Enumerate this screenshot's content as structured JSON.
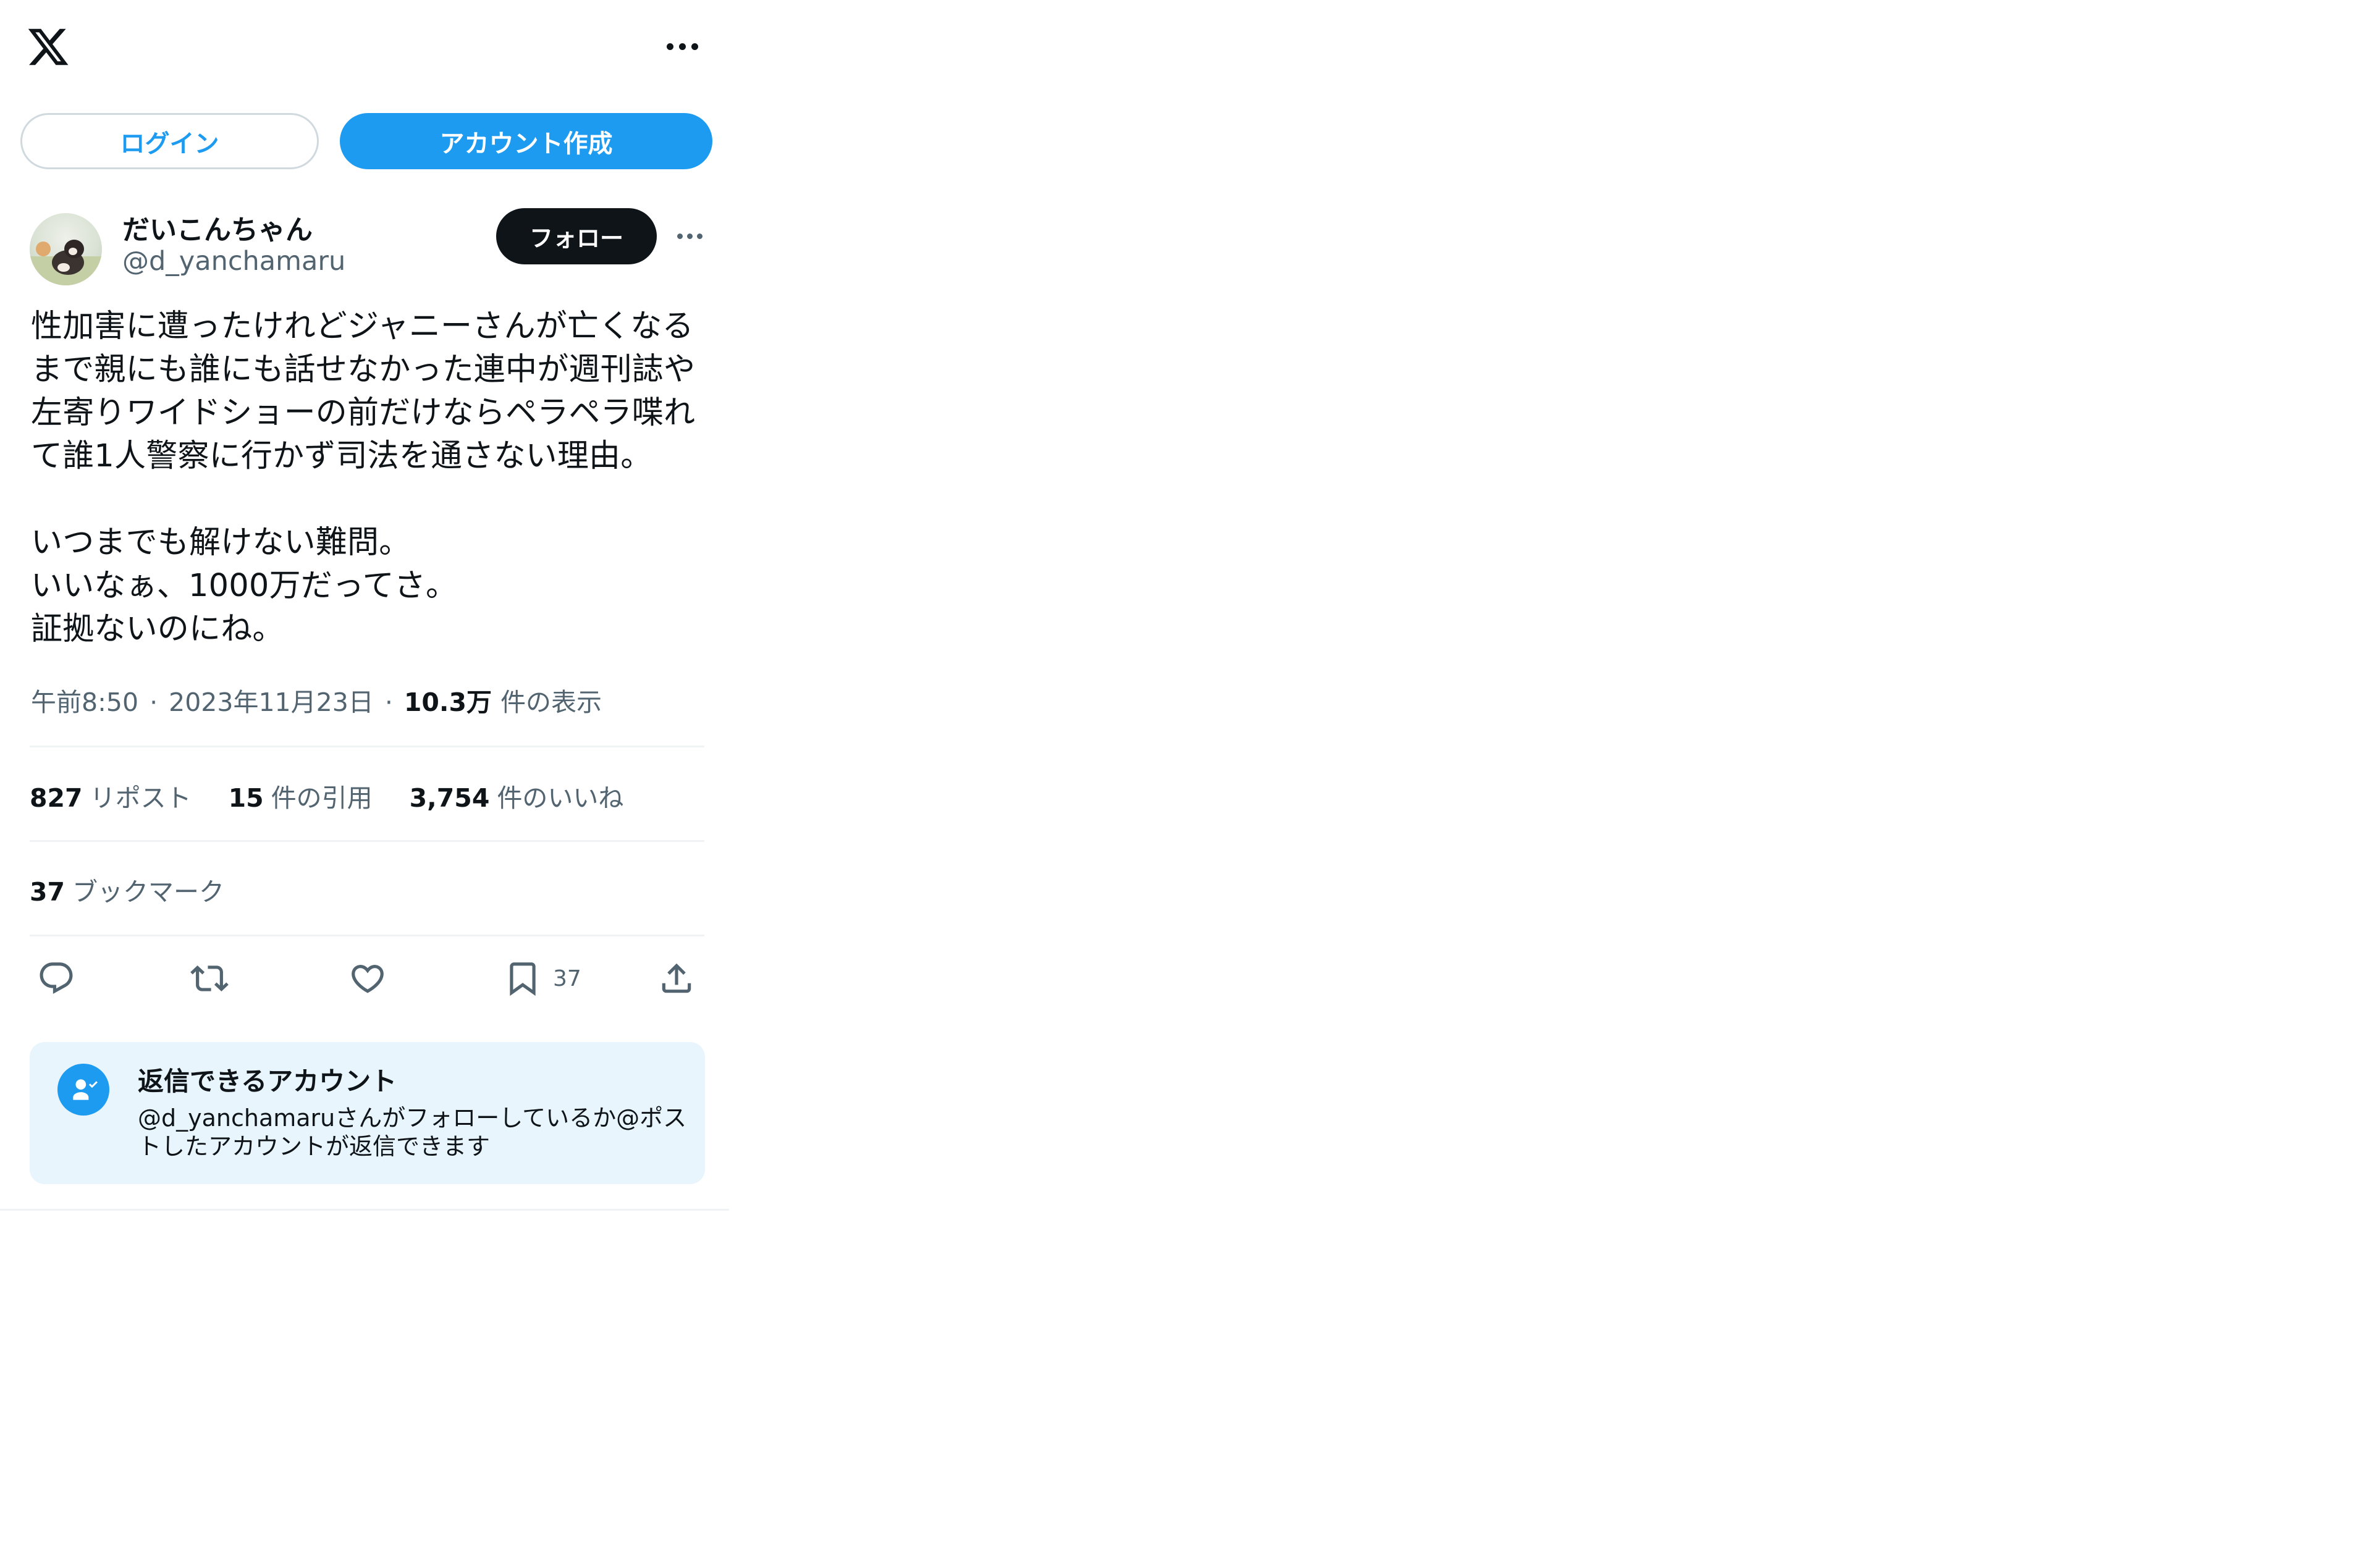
{
  "header": {
    "logo_icon": "x-logo-icon",
    "more_icon": "more-horizontal-icon"
  },
  "auth": {
    "login_label": "ログイン",
    "signup_label": "アカウント作成"
  },
  "post": {
    "author": {
      "name": "だいこんちゃん",
      "handle": "@d_yanchamaru",
      "avatar": "avatar-image"
    },
    "follow_label": "フォロー",
    "text": "性加害に遭ったけれどジャニーさんが亡くなるまで親にも誰にも話せなかった連中が週刊誌や左寄りワイドショーの前だけならペラペラ喋れて誰1人警察に行かず司法を通さない理由。\n\nいつまでも解けない難問。\nいいなぁ、1000万だってさ。\n証拠ないのにね。",
    "meta": {
      "time": "午前8:50",
      "date": "2023年11月23日",
      "views": "10.3万",
      "views_label": "件の表示",
      "separator": "·"
    },
    "stats": {
      "reposts": "827",
      "reposts_label": "リポスト",
      "quotes": "15",
      "quotes_label": "件の引用",
      "likes": "3,754",
      "likes_label": "件のいいね",
      "bookmarks": "37",
      "bookmarks_label": "ブックマーク"
    },
    "actions": {
      "reply_icon": "reply-icon",
      "repost_icon": "repost-icon",
      "like_icon": "like-icon",
      "bookmark_icon": "bookmark-icon",
      "bookmark_count": "37",
      "share_icon": "share-icon"
    }
  },
  "reply_restriction": {
    "title": "返信できるアカウント",
    "description": "@d_yanchamaruさんがフォローしているか@ポストしたアカウントが返信できます"
  },
  "colors": {
    "accent": "#1d9bf0",
    "text_primary": "#0f1419",
    "text_secondary": "#536471",
    "divider": "#eff3f4",
    "reply_box_bg": "#e8f5fd"
  }
}
